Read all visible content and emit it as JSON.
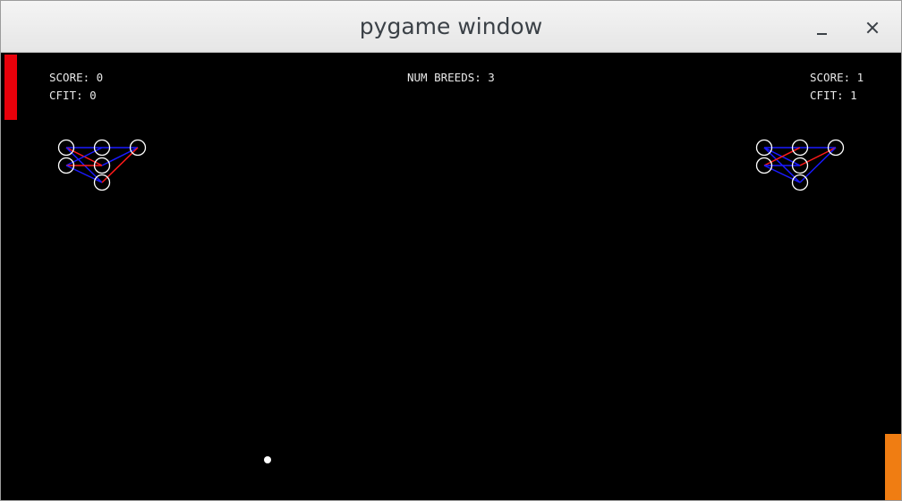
{
  "window": {
    "title": "pygame window"
  },
  "hud": {
    "left": {
      "score_label": "SCORE: 0",
      "cfit_label": "CFIT: 0"
    },
    "center": {
      "breeds_label": "NUM BREEDS: 3"
    },
    "right": {
      "score_label": "SCORE: 1",
      "cfit_label": "CFIT: 1"
    }
  },
  "colors": {
    "background": "#000000",
    "left_paddle": "#e8000a",
    "right_paddle": "#f07d12",
    "ball": "#ffffff",
    "positive_weight": "#1a1aff",
    "negative_weight": "#ff1a1a",
    "neuron_outline": "#ffffff"
  }
}
